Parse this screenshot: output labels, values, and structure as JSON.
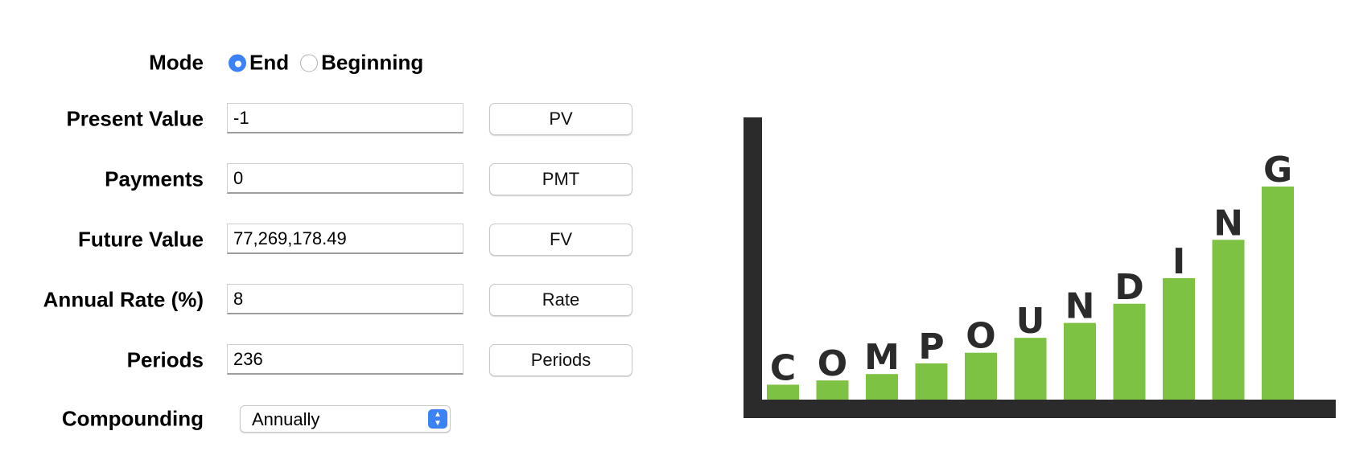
{
  "mode": {
    "label": "Mode",
    "options": [
      {
        "label": "End",
        "selected": true
      },
      {
        "label": "Beginning",
        "selected": false
      }
    ]
  },
  "fields": [
    {
      "label": "Present Value",
      "value": "-1",
      "button": "PV"
    },
    {
      "label": "Payments",
      "value": "0",
      "button": "PMT"
    },
    {
      "label": "Future Value",
      "value": "77,269,178.49",
      "button": "FV"
    },
    {
      "label": "Annual Rate (%)",
      "value": "8",
      "button": "Rate"
    },
    {
      "label": "Periods",
      "value": "236",
      "button": "Periods"
    }
  ],
  "compounding": {
    "label": "Compounding",
    "selected": "Annually"
  },
  "illustration": {
    "letters": [
      "C",
      "O",
      "M",
      "P",
      "O",
      "U",
      "N",
      "D",
      "I",
      "N",
      "G"
    ],
    "bar_levels": [
      0.07,
      0.09,
      0.12,
      0.17,
      0.22,
      0.29,
      0.36,
      0.45,
      0.57,
      0.75,
      1.0
    ],
    "bar_color": "#7dc242",
    "axis_color": "#2b2b2b",
    "letter_color": "#2b2b2b"
  },
  "colors": {
    "accent": "#3b82f6"
  }
}
